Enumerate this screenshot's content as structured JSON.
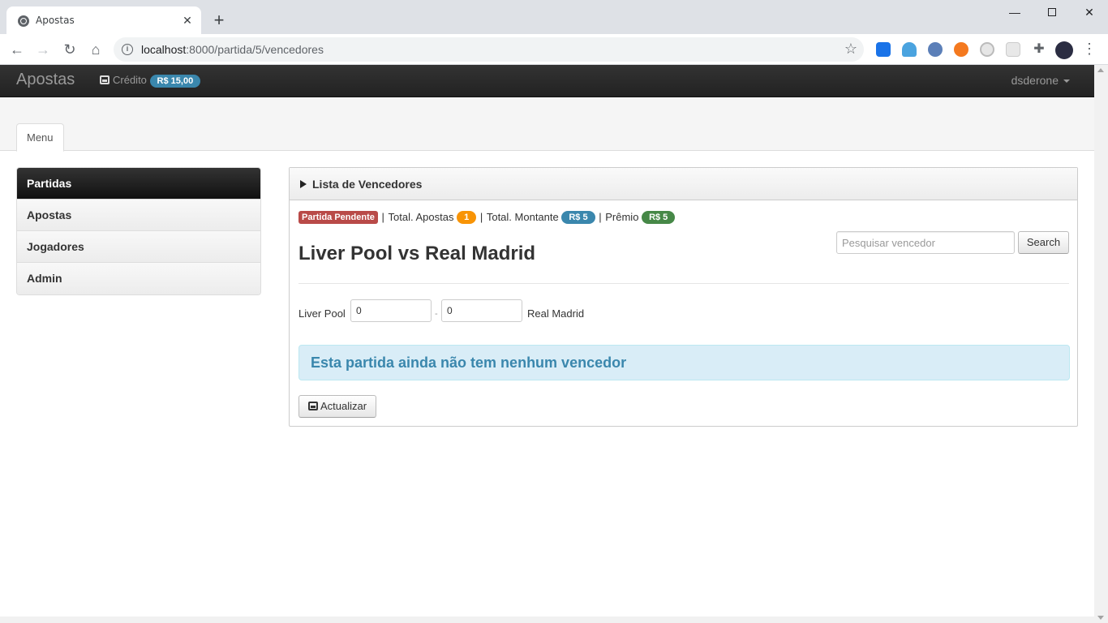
{
  "browser": {
    "tab_title": "Apostas",
    "tab_close": "✕",
    "new_tab": "+",
    "url_host": "localhost",
    "url_rest": ":8000/partida/5/vencedores",
    "window_controls": {
      "minimize": "—",
      "close": "✕"
    },
    "icons": [
      "globe-icon",
      "back-icon",
      "forward-icon",
      "reload-icon",
      "home-icon",
      "info-icon",
      "star-icon",
      "puzzle-icon",
      "profile-avatar",
      "menu-icon"
    ]
  },
  "navbar": {
    "brand": "Apostas",
    "credit_label": "Crédito",
    "credit_value": "R$ 15,00",
    "user": "dsderone"
  },
  "subheader": {
    "tab_label": "Menu"
  },
  "sidebar": {
    "items": [
      {
        "label": "Partidas",
        "active": true
      },
      {
        "label": "Apostas",
        "active": false
      },
      {
        "label": "Jogadores",
        "active": false
      },
      {
        "label": "Admin",
        "active": false
      }
    ]
  },
  "panel": {
    "title": "Lista de Vencedores",
    "status": {
      "state_label": "Partida Pendente",
      "total_apostas_label": "Total. Apostas",
      "total_apostas_value": "1",
      "total_montante_label": "Total. Montante",
      "total_montante_value": "R$ 5",
      "premio_label": "Prêmio",
      "premio_value": "R$ 5",
      "separator": "|"
    },
    "match_title": "Liver Pool vs Real Madrid",
    "search": {
      "placeholder": "Pesquisar vencedor",
      "button_label": "Search"
    },
    "score": {
      "team_a": "Liver Pool",
      "team_a_value": "0",
      "separator": "-",
      "team_b_value": "0",
      "team_b": "Real Madrid"
    },
    "alert_message": "Esta partida ainda não tem nenhum vencedor",
    "update_button_label": "Actualizar"
  },
  "colors": {
    "navbar": "#222222",
    "badge_info": "#3a87ad",
    "badge_warning": "#f89406",
    "badge_success": "#468847",
    "label_important": "#b94a48",
    "alert_bg": "#d9edf7",
    "alert_text": "#3a87ad"
  }
}
